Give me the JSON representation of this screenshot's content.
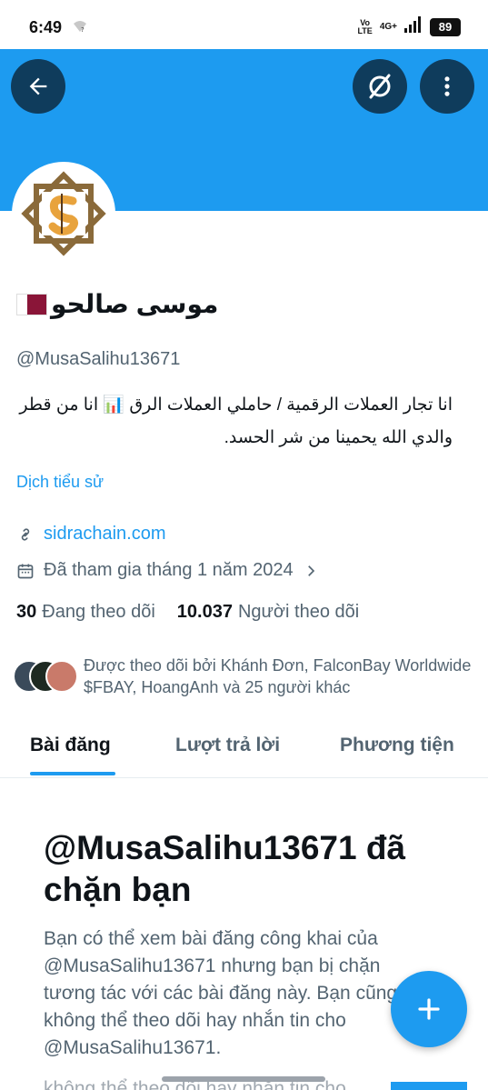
{
  "status_bar": {
    "time": "6:49",
    "volte_line1": "Vo",
    "volte_line2": "LTE",
    "network": "4G+",
    "battery": "89"
  },
  "header": {
    "back_icon": "arrow-left-icon",
    "grok_icon": "grok-icon",
    "more_icon": "more-vertical-icon",
    "banner_color": "#1d9bf0"
  },
  "profile": {
    "display_name": "موسى صالحو",
    "flag": "qatar-flag",
    "handle": "@MusaSalihu13671",
    "bio_line1": "انا تجار العملات الرقمية / حاملي العملات الرق 📊 انا من قطر",
    "bio_line2": "والدي الله يحمينا من شر الحسد.",
    "translate_bio": "Dịch tiểu sử",
    "website": "sidrachain.com",
    "joined": "Đã tham gia tháng 1 năm 2024",
    "following_count": "30",
    "following_label": "Đang theo dõi",
    "followers_count": "10.037",
    "followers_label": "Người theo dõi",
    "followed_by": "Được theo dõi bởi Khánh Đơn, FalconBay Worldwide $FBAY, HoangAnh và 25 người khác"
  },
  "tabs": [
    {
      "label": "Bài đăng"
    },
    {
      "label": "Lượt trả lời"
    },
    {
      "label": "Phương tiện"
    }
  ],
  "blocked": {
    "title": "@MusaSalihu13671 đã chặn bạn",
    "body": "Bạn có thể xem bài đăng công khai của @MusaSalihu13671 nhưng bạn bị chặn tương tác với các bài đăng này. Bạn cũng không thể theo dõi hay nhắn tin cho @MusaSalihu13671.",
    "ghost": "không thể theo dõi hay nhắn tin cho"
  },
  "fab": {
    "icon": "plus-icon"
  },
  "colors": {
    "accent": "#1d9bf0",
    "text": "#0f1419",
    "secondary": "#536471"
  }
}
